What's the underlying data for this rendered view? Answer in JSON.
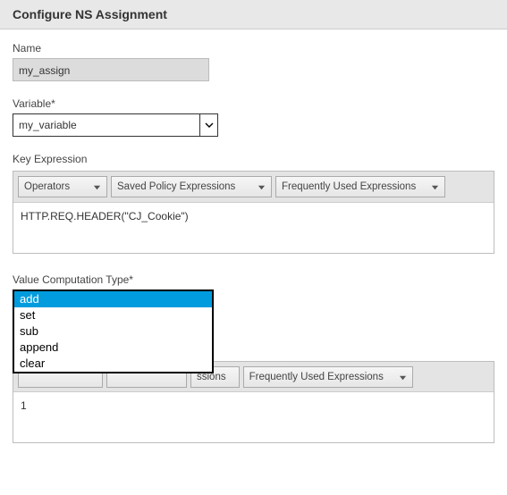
{
  "header": {
    "title": "Configure NS Assignment"
  },
  "name": {
    "label": "Name",
    "value": "my_assign"
  },
  "variable": {
    "label": "Variable*",
    "value": "my_variable"
  },
  "keyExpr": {
    "label": "Key Expression",
    "operators": "Operators",
    "saved": "Saved Policy Expressions",
    "frequent": "Frequently Used Expressions",
    "value": "HTTP.REQ.HEADER(\"CJ_Cookie\")"
  },
  "vct": {
    "label": "Value Computation Type*",
    "options": [
      "add",
      "set",
      "sub",
      "append",
      "clear"
    ],
    "selected": "add"
  },
  "valExpr": {
    "savedTrunc": "ssions",
    "frequent": "Frequently Used Expressions",
    "value": "1"
  }
}
